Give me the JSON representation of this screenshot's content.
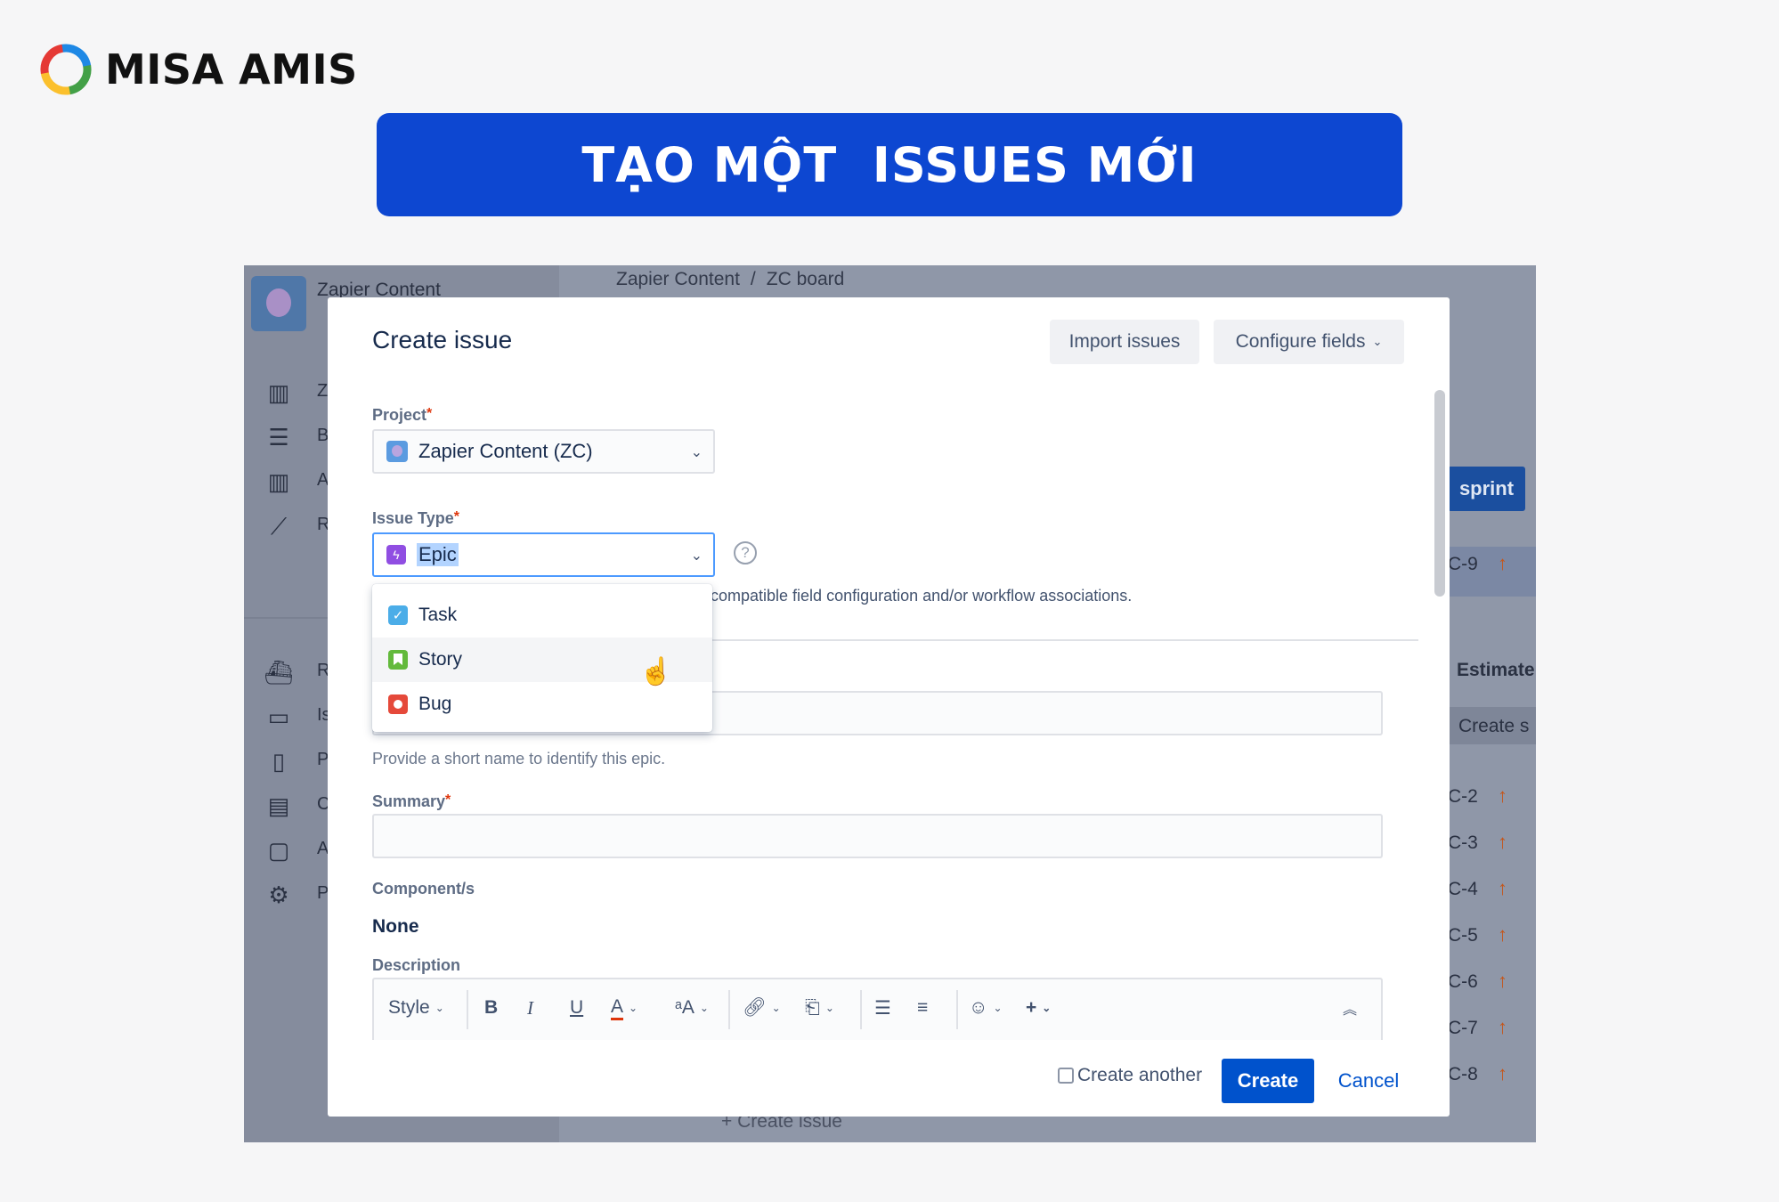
{
  "brand": {
    "name": "MISA AMIS"
  },
  "banner": {
    "title": "TẠO MỘT  ISSUES MỚI"
  },
  "background": {
    "project_name": "Zapier Content",
    "breadcrumb": [
      "Zapier Content",
      "ZC board"
    ],
    "sidebar_letters": [
      "Z",
      "B",
      "A",
      "R",
      "R",
      "Is",
      "P",
      "C",
      "A",
      "P"
    ],
    "sprint_button": "sprint",
    "estimate_header": "Estimate",
    "create_sprint_partial": "Create s",
    "row_keys": [
      "C-9",
      "C-2",
      "C-3",
      "C-4",
      "C-5",
      "C-6",
      "C-7",
      "C-8"
    ],
    "create_issue_link": "+ Create issue"
  },
  "dialog": {
    "title": "Create issue",
    "import_button": "Import issues",
    "configure_button": "Configure fields",
    "project": {
      "label": "Project",
      "value": "Zapier Content (ZC)"
    },
    "issue_type": {
      "label": "Issue Type",
      "value": "Epic",
      "options": [
        {
          "label": "Task",
          "icon": "task-icon"
        },
        {
          "label": "Story",
          "icon": "story-icon"
        },
        {
          "label": "Bug",
          "icon": "bug-icon"
        }
      ],
      "hovered_option": "Story"
    },
    "warning_text": "compatible field configuration and/or workflow associations.",
    "epic_name_helper": "Provide a short name to identify this epic.",
    "summary": {
      "label": "Summary",
      "value": ""
    },
    "components": {
      "label": "Component/s",
      "value": "None"
    },
    "description": {
      "label": "Description",
      "style_label": "Style"
    },
    "footer": {
      "create_another": "Create another",
      "create_button": "Create",
      "cancel_button": "Cancel"
    }
  },
  "colors": {
    "banner_bg": "#0d47d1",
    "primary": "#0052cc",
    "required": "#de350b",
    "epic": "#904ee2",
    "task": "#4bade8",
    "story": "#63ba3c",
    "bug": "#e5493a"
  }
}
